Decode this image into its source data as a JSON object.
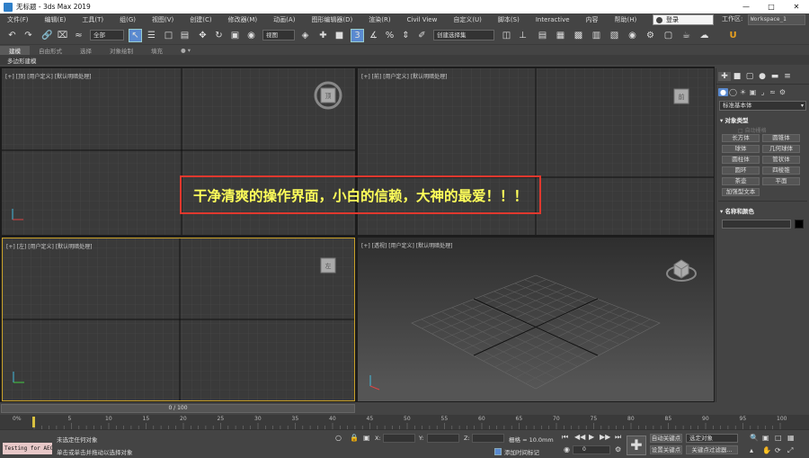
{
  "window": {
    "title": "无标题 - 3ds Max 2019"
  },
  "menu": {
    "items": [
      "文件(F)",
      "编辑(E)",
      "工具(T)",
      "组(G)",
      "视图(V)",
      "创建(C)",
      "修改器(M)",
      "动画(A)",
      "图形编辑器(D)",
      "渲染(R)",
      "Civil View",
      "自定义(U)",
      "脚本(S)",
      "Interactive",
      "内容",
      "帮助(H)"
    ],
    "login": "登录",
    "workspace_label": "工作区:",
    "workspace_value": "Workspace_1"
  },
  "toolbar": {
    "selection_filter": "全部",
    "ref_coord": "视图",
    "named_selection": "创建选择集"
  },
  "ribbon": {
    "tabs": [
      "建模",
      "自由形式",
      "选择",
      "对象绘制",
      "填充"
    ],
    "active_tab": 0,
    "sub_label": "多边形建模"
  },
  "viewports": {
    "top": "[+] [顶] [用户定义] [默认明暗处理]",
    "front": "[+] [前] [用户定义] [默认明暗处理]",
    "left": "[+] [左] [用户定义] [默认明暗处理]",
    "perspective": "[+] [透视] [用户定义] [默认明暗处理]"
  },
  "annotation": {
    "text": "干净清爽的操作界面，小白的信赖，大神的最爱！！！",
    "border_color": "#e0382e",
    "text_color": "#ffff5a"
  },
  "command_panel": {
    "dropdown": "标准基本体",
    "object_type_title": "对象类型",
    "autogrid": "自动栅格",
    "buttons": [
      "长方体",
      "圆锥体",
      "球体",
      "几何球体",
      "圆柱体",
      "管状体",
      "圆环",
      "四棱锥",
      "茶壶",
      "平面"
    ],
    "extra_button": "加强型文本",
    "name_color_title": "名称和颜色"
  },
  "timeline": {
    "slider_text": "0 / 100",
    "ticks": [
      "0",
      "5",
      "10",
      "15",
      "20",
      "25",
      "30",
      "35",
      "40",
      "45",
      "50",
      "55",
      "60",
      "65",
      "70",
      "75",
      "80",
      "85",
      "90",
      "95",
      "100"
    ],
    "ticks_small": "0%"
  },
  "status": {
    "maxscript": "Testing for AEC",
    "msg1": "未选定任何对象",
    "msg2": "单击或单击并拖动以选择对象",
    "x_label": "X:",
    "y_label": "Y:",
    "z_label": "Z:",
    "grid": "栅格 = 10.0mm",
    "add_time_tag": "添加时间标记",
    "frame": "0",
    "auto_key": "自动关键点",
    "set_key": "设置关键点",
    "selected_object": "选定对象",
    "key_filters": "关键点过滤器..."
  },
  "colors": {
    "accent": "#5a8ad0",
    "active_viewport": "#c8a028"
  }
}
